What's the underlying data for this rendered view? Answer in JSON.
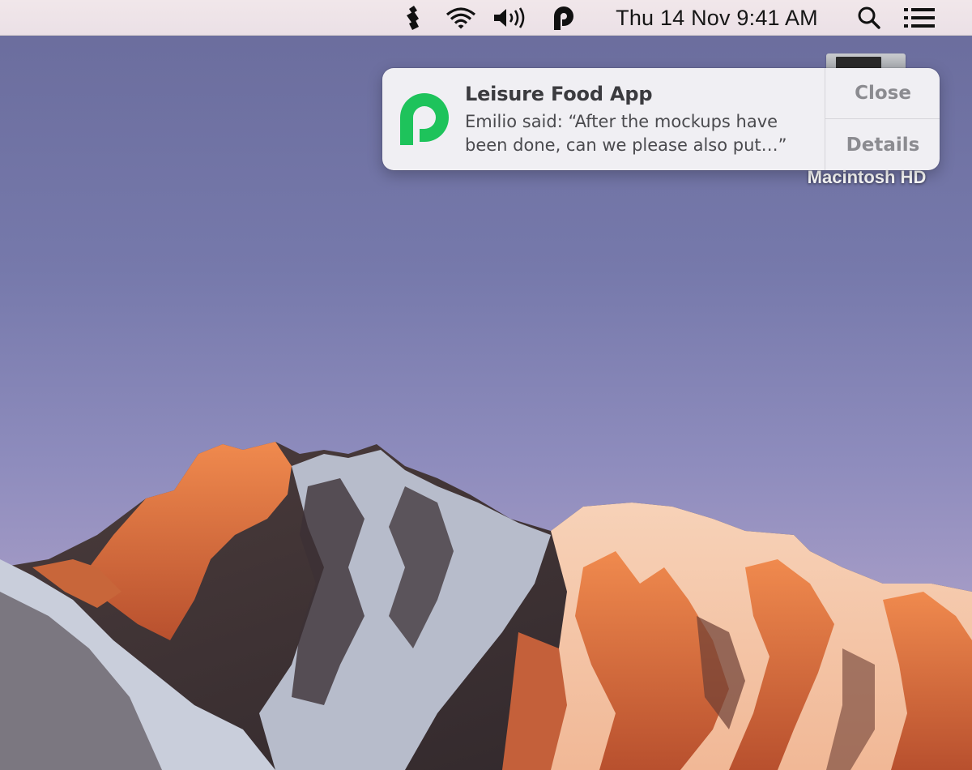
{
  "menubar": {
    "datetime": "Thu 14 Nov  9:41 AM",
    "icons": [
      "app-status-icon",
      "wifi-icon",
      "volume-icon",
      "leisure-food-app-icon",
      "spotlight-search-icon",
      "notification-center-icon"
    ]
  },
  "desktop": {
    "drive_label": "Macintosh HD"
  },
  "notification": {
    "app_name": "Leisure Food App",
    "message": "Emilio said: “After the mockups have been done, can we please also put…”",
    "close_label": "Close",
    "details_label": "Details",
    "brand_color": "#1ec35b"
  }
}
